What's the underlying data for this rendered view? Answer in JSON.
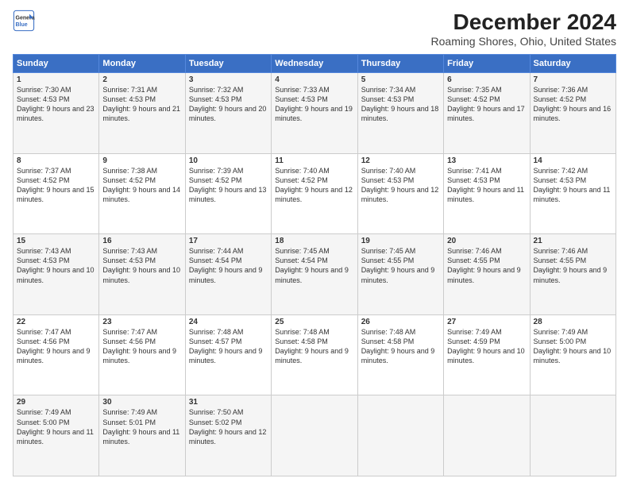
{
  "logo": {
    "line1": "General",
    "line2": "Blue"
  },
  "title": "December 2024",
  "subtitle": "Roaming Shores, Ohio, United States",
  "weekdays": [
    "Sunday",
    "Monday",
    "Tuesday",
    "Wednesday",
    "Thursday",
    "Friday",
    "Saturday"
  ],
  "weeks": [
    [
      {
        "day": "1",
        "sunrise": "7:30 AM",
        "sunset": "4:53 PM",
        "daylight": "9 hours and 23 minutes."
      },
      {
        "day": "2",
        "sunrise": "7:31 AM",
        "sunset": "4:53 PM",
        "daylight": "9 hours and 21 minutes."
      },
      {
        "day": "3",
        "sunrise": "7:32 AM",
        "sunset": "4:53 PM",
        "daylight": "9 hours and 20 minutes."
      },
      {
        "day": "4",
        "sunrise": "7:33 AM",
        "sunset": "4:53 PM",
        "daylight": "9 hours and 19 minutes."
      },
      {
        "day": "5",
        "sunrise": "7:34 AM",
        "sunset": "4:53 PM",
        "daylight": "9 hours and 18 minutes."
      },
      {
        "day": "6",
        "sunrise": "7:35 AM",
        "sunset": "4:52 PM",
        "daylight": "9 hours and 17 minutes."
      },
      {
        "day": "7",
        "sunrise": "7:36 AM",
        "sunset": "4:52 PM",
        "daylight": "9 hours and 16 minutes."
      }
    ],
    [
      {
        "day": "8",
        "sunrise": "7:37 AM",
        "sunset": "4:52 PM",
        "daylight": "9 hours and 15 minutes."
      },
      {
        "day": "9",
        "sunrise": "7:38 AM",
        "sunset": "4:52 PM",
        "daylight": "9 hours and 14 minutes."
      },
      {
        "day": "10",
        "sunrise": "7:39 AM",
        "sunset": "4:52 PM",
        "daylight": "9 hours and 13 minutes."
      },
      {
        "day": "11",
        "sunrise": "7:40 AM",
        "sunset": "4:52 PM",
        "daylight": "9 hours and 12 minutes."
      },
      {
        "day": "12",
        "sunrise": "7:40 AM",
        "sunset": "4:53 PM",
        "daylight": "9 hours and 12 minutes."
      },
      {
        "day": "13",
        "sunrise": "7:41 AM",
        "sunset": "4:53 PM",
        "daylight": "9 hours and 11 minutes."
      },
      {
        "day": "14",
        "sunrise": "7:42 AM",
        "sunset": "4:53 PM",
        "daylight": "9 hours and 11 minutes."
      }
    ],
    [
      {
        "day": "15",
        "sunrise": "7:43 AM",
        "sunset": "4:53 PM",
        "daylight": "9 hours and 10 minutes."
      },
      {
        "day": "16",
        "sunrise": "7:43 AM",
        "sunset": "4:53 PM",
        "daylight": "9 hours and 10 minutes."
      },
      {
        "day": "17",
        "sunrise": "7:44 AM",
        "sunset": "4:54 PM",
        "daylight": "9 hours and 9 minutes."
      },
      {
        "day": "18",
        "sunrise": "7:45 AM",
        "sunset": "4:54 PM",
        "daylight": "9 hours and 9 minutes."
      },
      {
        "day": "19",
        "sunrise": "7:45 AM",
        "sunset": "4:55 PM",
        "daylight": "9 hours and 9 minutes."
      },
      {
        "day": "20",
        "sunrise": "7:46 AM",
        "sunset": "4:55 PM",
        "daylight": "9 hours and 9 minutes."
      },
      {
        "day": "21",
        "sunrise": "7:46 AM",
        "sunset": "4:55 PM",
        "daylight": "9 hours and 9 minutes."
      }
    ],
    [
      {
        "day": "22",
        "sunrise": "7:47 AM",
        "sunset": "4:56 PM",
        "daylight": "9 hours and 9 minutes."
      },
      {
        "day": "23",
        "sunrise": "7:47 AM",
        "sunset": "4:56 PM",
        "daylight": "9 hours and 9 minutes."
      },
      {
        "day": "24",
        "sunrise": "7:48 AM",
        "sunset": "4:57 PM",
        "daylight": "9 hours and 9 minutes."
      },
      {
        "day": "25",
        "sunrise": "7:48 AM",
        "sunset": "4:58 PM",
        "daylight": "9 hours and 9 minutes."
      },
      {
        "day": "26",
        "sunrise": "7:48 AM",
        "sunset": "4:58 PM",
        "daylight": "9 hours and 9 minutes."
      },
      {
        "day": "27",
        "sunrise": "7:49 AM",
        "sunset": "4:59 PM",
        "daylight": "9 hours and 10 minutes."
      },
      {
        "day": "28",
        "sunrise": "7:49 AM",
        "sunset": "5:00 PM",
        "daylight": "9 hours and 10 minutes."
      }
    ],
    [
      {
        "day": "29",
        "sunrise": "7:49 AM",
        "sunset": "5:00 PM",
        "daylight": "9 hours and 11 minutes."
      },
      {
        "day": "30",
        "sunrise": "7:49 AM",
        "sunset": "5:01 PM",
        "daylight": "9 hours and 11 minutes."
      },
      {
        "day": "31",
        "sunrise": "7:50 AM",
        "sunset": "5:02 PM",
        "daylight": "9 hours and 12 minutes."
      },
      null,
      null,
      null,
      null
    ]
  ]
}
